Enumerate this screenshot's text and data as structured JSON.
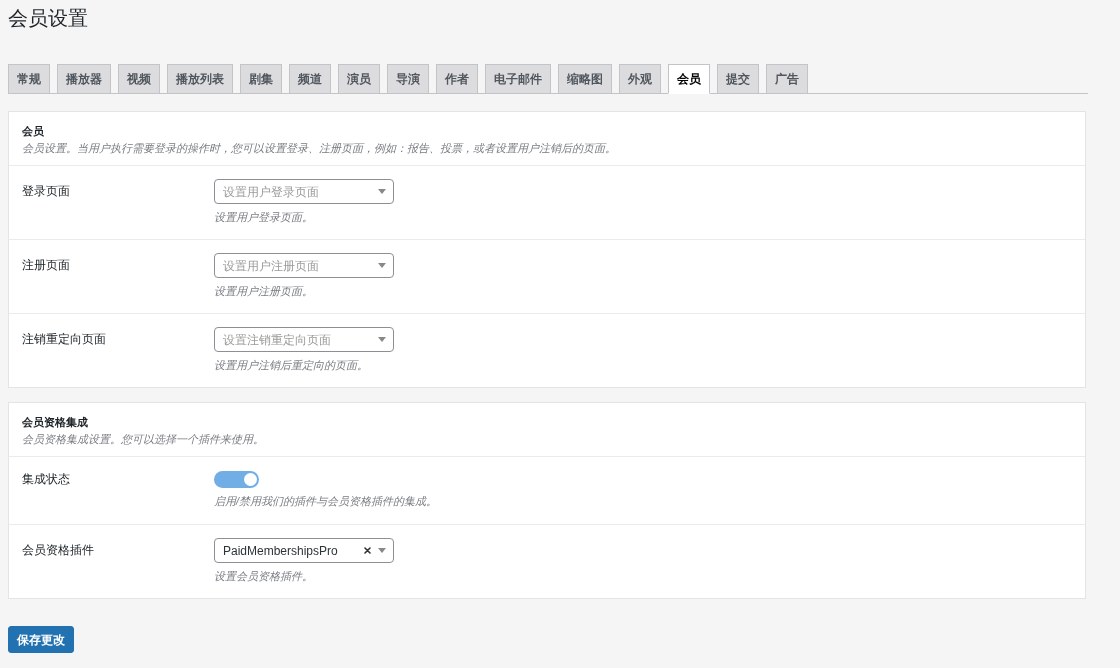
{
  "page": {
    "title": "会员设置"
  },
  "tabs": [
    {
      "label": "常规",
      "selected": false
    },
    {
      "label": "播放器",
      "selected": false
    },
    {
      "label": "视频",
      "selected": false
    },
    {
      "label": "播放列表",
      "selected": false
    },
    {
      "label": "剧集",
      "selected": false
    },
    {
      "label": "频道",
      "selected": false
    },
    {
      "label": "演员",
      "selected": false
    },
    {
      "label": "导演",
      "selected": false
    },
    {
      "label": "作者",
      "selected": false
    },
    {
      "label": "电子邮件",
      "selected": false
    },
    {
      "label": "缩略图",
      "selected": false
    },
    {
      "label": "外观",
      "selected": false
    },
    {
      "label": "会员",
      "selected": true
    },
    {
      "label": "提交",
      "selected": false
    },
    {
      "label": "广告",
      "selected": false
    }
  ],
  "sections": [
    {
      "title": "会员",
      "description": "会员设置。当用户执行需要登录的操作时，您可以设置登录、注册页面，例如：报告、投票，或者设置用户注销后的页面。",
      "fields": [
        {
          "kind": "select",
          "label": "登录页面",
          "placeholder": "设置用户登录页面",
          "help": "设置用户登录页面。"
        },
        {
          "kind": "select",
          "label": "注册页面",
          "placeholder": "设置用户注册页面",
          "help": "设置用户注册页面。"
        },
        {
          "kind": "select",
          "label": "注销重定向页面",
          "placeholder": "设置注销重定向页面",
          "help": "设置用户注销后重定向的页面。"
        }
      ]
    },
    {
      "title": "会员资格集成",
      "description": "会员资格集成设置。您可以选择一个插件来使用。",
      "fields": [
        {
          "kind": "toggle",
          "label": "集成状态",
          "on": true,
          "help": "启用/禁用我们的插件与会员资格插件的集成。"
        },
        {
          "kind": "select",
          "label": "会员资格插件",
          "value": "PaidMembershipsPro",
          "help": "设置会员资格插件。"
        }
      ]
    }
  ],
  "save_button": {
    "label": "保存更改"
  }
}
